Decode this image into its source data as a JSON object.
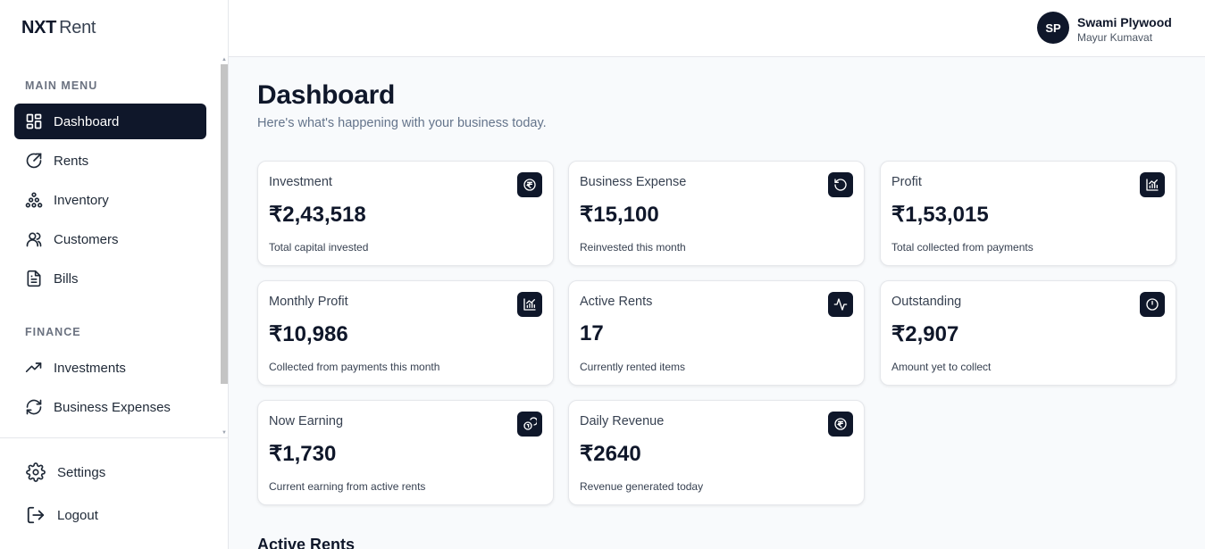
{
  "brand": {
    "part1": "NXT",
    "part2": "Rent"
  },
  "user": {
    "initials": "SP",
    "name": "Swami Plywood",
    "subtitle": "Mayur Kumavat"
  },
  "sidebar": {
    "main_menu_label": "MAIN MENU",
    "main_items": [
      {
        "label": "Dashboard",
        "icon": "dashboard-icon",
        "active": true
      },
      {
        "label": "Rents",
        "icon": "rents-icon"
      },
      {
        "label": "Inventory",
        "icon": "inventory-icon"
      },
      {
        "label": "Customers",
        "icon": "customers-icon"
      },
      {
        "label": "Bills",
        "icon": "bills-icon"
      }
    ],
    "finance_label": "FINANCE",
    "finance_items": [
      {
        "label": "Investments",
        "icon": "trending-up-icon"
      },
      {
        "label": "Business Expenses",
        "icon": "refresh-icon"
      }
    ],
    "bottom_items": [
      {
        "label": "Settings",
        "icon": "gear-icon"
      },
      {
        "label": "Logout",
        "icon": "logout-icon"
      }
    ]
  },
  "page": {
    "title": "Dashboard",
    "subtitle": "Here's what's happening with your business today."
  },
  "cards": [
    {
      "label": "Investment",
      "value": "₹2,43,518",
      "desc": "Total capital invested",
      "icon": "rupee-icon"
    },
    {
      "label": "Business Expense",
      "value": "₹15,100",
      "desc": "Reinvested this month",
      "icon": "rotate-ccw-icon"
    },
    {
      "label": "Profit",
      "value": "₹1,53,015",
      "desc": "Total collected from payments",
      "icon": "bar-chart-icon"
    },
    {
      "label": "Monthly Profit",
      "value": "₹10,986",
      "desc": "Collected from payments this month",
      "icon": "bar-chart-icon"
    },
    {
      "label": "Active Rents",
      "value": "17",
      "desc": "Currently rented items",
      "icon": "activity-icon"
    },
    {
      "label": "Outstanding",
      "value": "₹2,907",
      "desc": "Amount yet to collect",
      "icon": "clock-icon"
    },
    {
      "label": "Now Earning",
      "value": "₹1,730",
      "desc": "Current earning from active rents",
      "icon": "coins-icon"
    },
    {
      "label": "Daily Revenue",
      "value": "₹2640",
      "desc": "Revenue generated today",
      "icon": "rupee-icon"
    }
  ],
  "sections": {
    "active_rents_title": "Active Rents"
  },
  "colors": {
    "primary": "#0f172a",
    "muted": "#64748b",
    "background": "#f8fafc",
    "border": "#e5e7eb"
  }
}
